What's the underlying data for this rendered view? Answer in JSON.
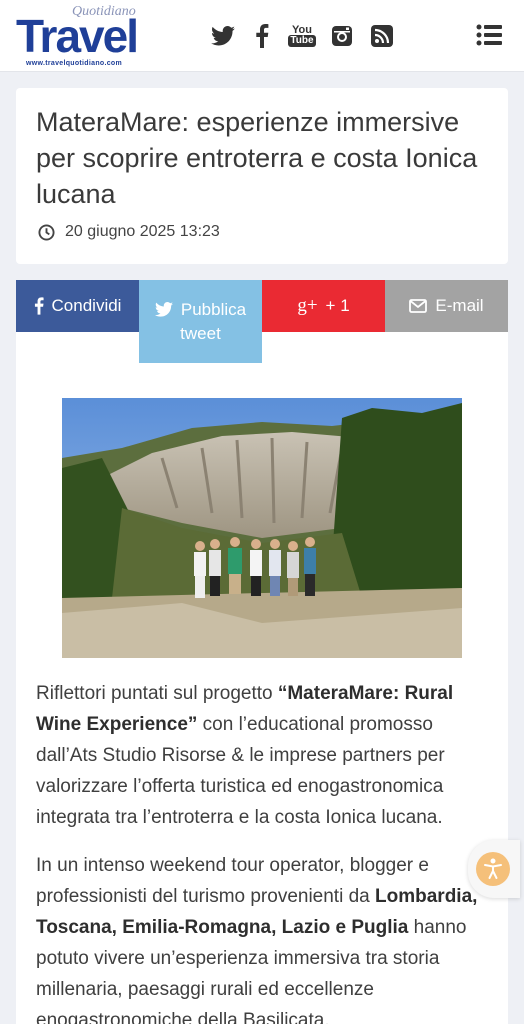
{
  "header": {
    "logo_top": "Quotidiano",
    "logo_main": "Travel",
    "logo_url": "www.travelquotidiano.com",
    "icons": [
      "twitter-icon",
      "facebook-icon",
      "youtube-icon",
      "instagram-icon",
      "rss-icon",
      "menu-icon"
    ],
    "youtube_text_1": "You",
    "youtube_text_2": "Tube"
  },
  "article": {
    "title": "MateraMare: esperienze immersive per scoprire entroterra e costa Ionica lucana",
    "date": "20 giugno 2025 13:23"
  },
  "share": {
    "facebook": "Condividi",
    "twitter_1": "Pubblica",
    "twitter_2": "tweet",
    "gplus": "+ 1",
    "gplus_icon": "g+",
    "email": "E-mail"
  },
  "body": {
    "p1_a": "Riflettori puntati sul progetto ",
    "p1_b": "“MateraMare: Rural Wine Experience”",
    "p1_c": " con l’educational promosso dall’Ats Studio Risorse & le imprese partners per valorizzare l’offerta turistica ed enogastronomica integrata tra l’entroterra e la costa Ionica lucana.",
    "p2_a": "In un intenso weekend tour operator, blogger e professionisti del turismo provenienti da ",
    "p2_b": "Lombardia, Toscana, Emilia-Romagna, Lazio e Puglia",
    "p2_c": " hanno potuto vivere un’esperienza immersiva tra storia millenaria, paesaggi rurali ed eccellenze enogastronomiche della Basilicata."
  },
  "colors": {
    "brand_blue": "#1f3f98",
    "facebook": "#3c5a9a",
    "twitter": "#84c1e4",
    "gplus": "#ea2a33",
    "email": "#a3a3a3",
    "accessibility": "#f5c07a"
  }
}
